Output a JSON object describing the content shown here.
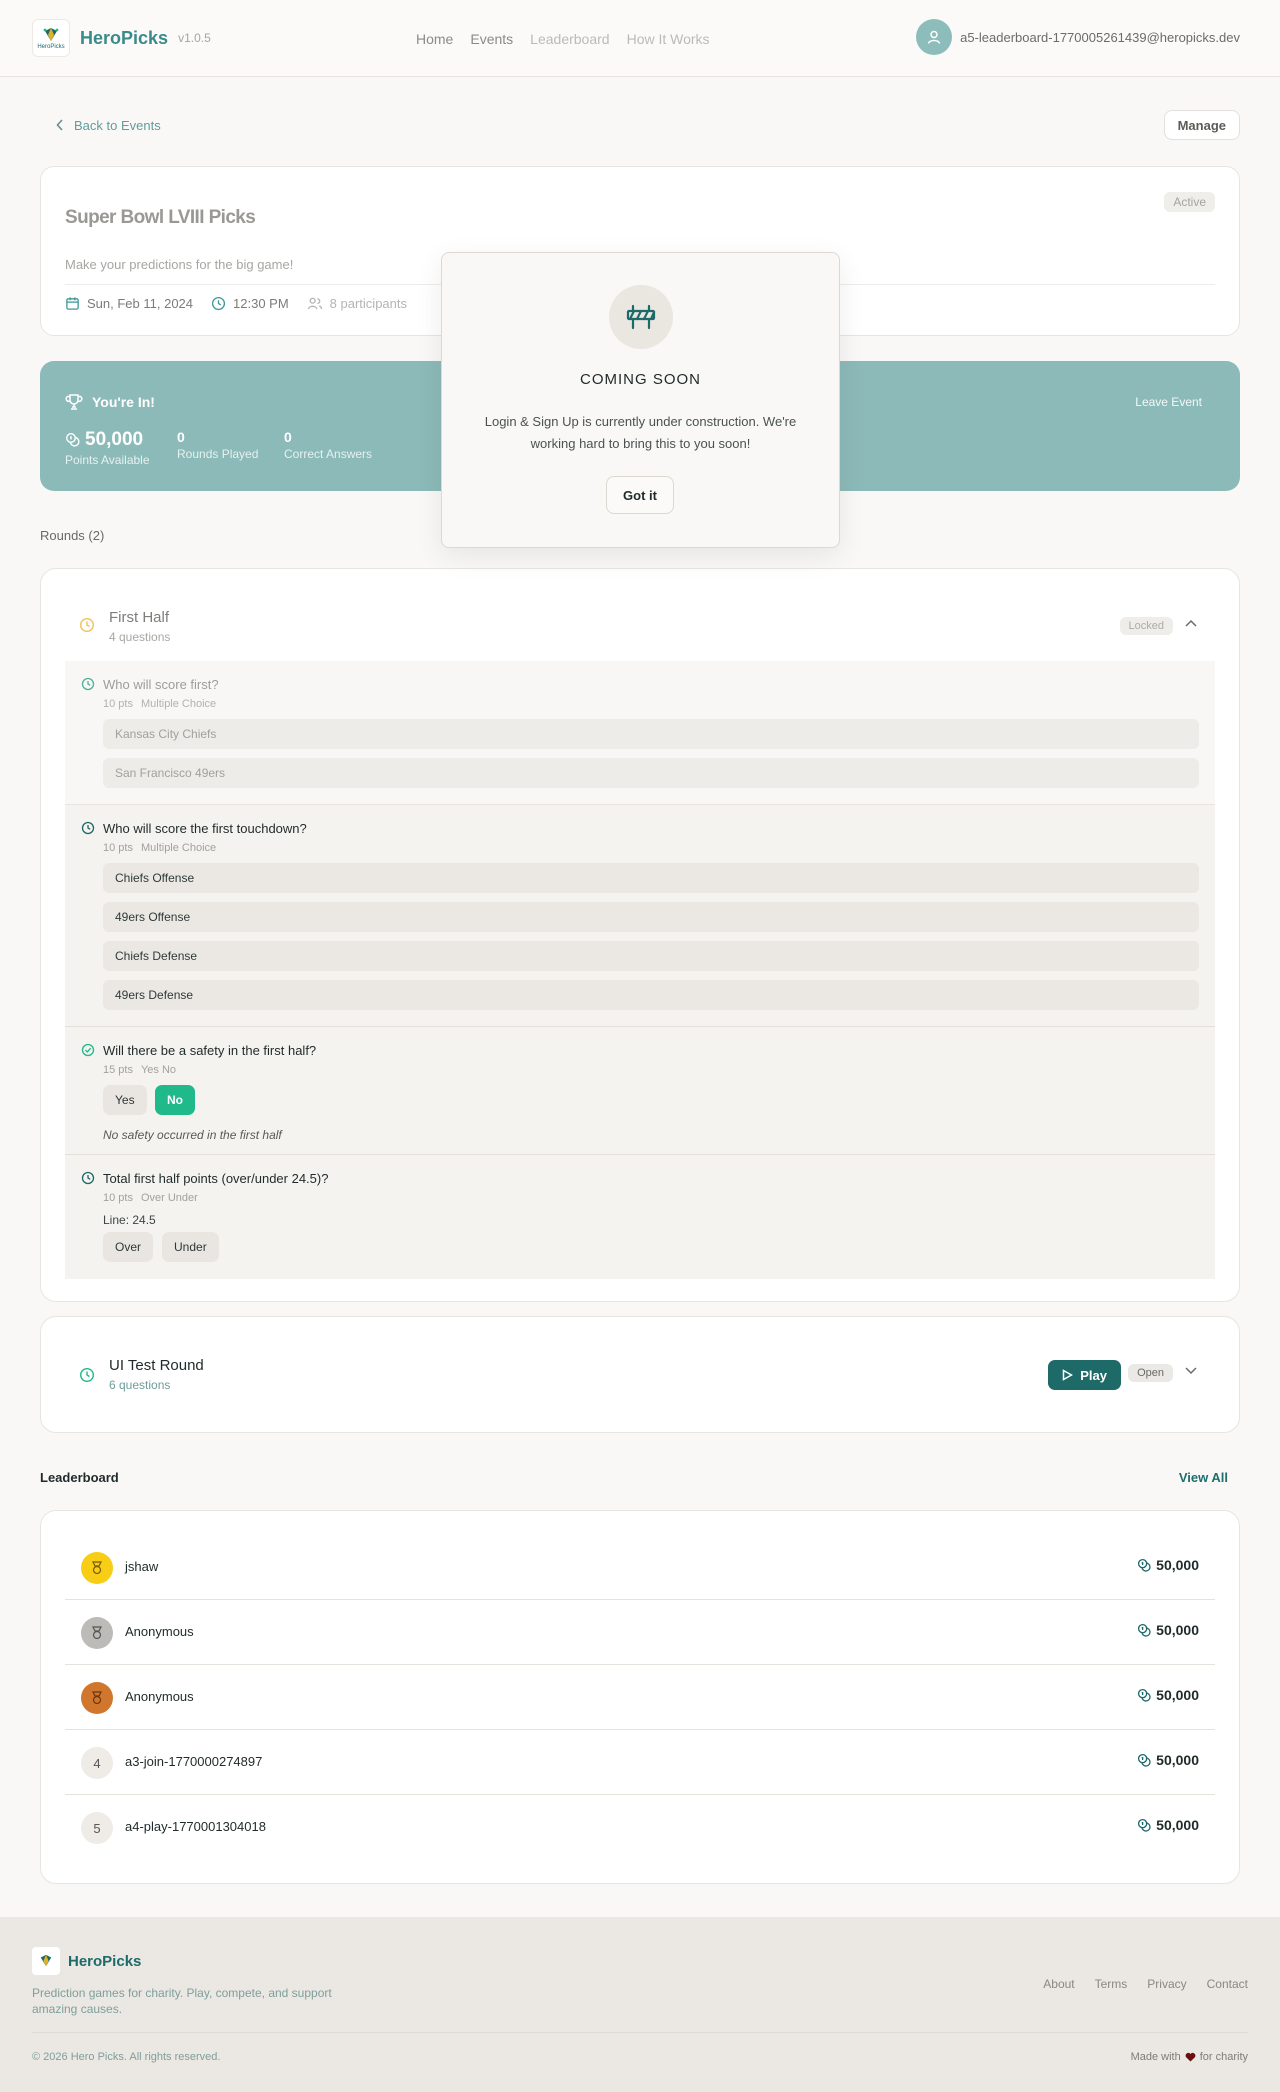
{
  "header": {
    "logo_text": "HeroPicks",
    "brand": "HeroPicks",
    "version": "v1.0.5",
    "nav": [
      "Home",
      "Events",
      "Leaderboard",
      "How It Works"
    ],
    "user_email": "a5-leaderboard-1770005261439@heropicks.dev"
  },
  "back_label": "Back to Events",
  "manage_label": "Manage",
  "event": {
    "title": "Super Bowl LVIII Picks",
    "status": "Active",
    "description": "Make your predictions for the big game!",
    "date": "Sun, Feb 11, 2024",
    "time": "12:30 PM",
    "participants": "8 participants"
  },
  "membership": {
    "title": "You're In!",
    "leave_label": "Leave Event",
    "points_value": "50,000",
    "points_label": "Points Available",
    "rounds_value": "0",
    "rounds_label": "Rounds Played",
    "correct_value": "0",
    "correct_label": "Correct Answers"
  },
  "rounds_title": "Rounds (2)",
  "round1": {
    "title": "First Half",
    "subtitle": "4 questions",
    "status": "Locked",
    "questions": [
      {
        "title": "Who will score first?",
        "points": "10 pts",
        "type": "Multiple Choice",
        "options": [
          "Kansas City Chiefs",
          "San Francisco 49ers"
        ]
      },
      {
        "title": "Who will score the first touchdown?",
        "points": "10 pts",
        "type": "Multiple Choice",
        "options": [
          "Chiefs Offense",
          "49ers Offense",
          "Chiefs Defense",
          "49ers Defense"
        ]
      },
      {
        "title": "Will there be a safety in the first half?",
        "points": "15 pts",
        "type": "Yes No",
        "options": [
          "Yes",
          "No"
        ],
        "selected": "No",
        "note": "No safety occurred in the first half"
      },
      {
        "title": "Total first half points (over/under 24.5)?",
        "points": "10 pts",
        "type": "Over Under",
        "line": "Line: 24.5",
        "options": [
          "Over",
          "Under"
        ]
      }
    ]
  },
  "round2": {
    "title": "UI Test Round",
    "subtitle": "6 questions",
    "play_label": "Play",
    "status": "Open"
  },
  "leaderboard": {
    "title": "Leaderboard",
    "view_all": "View All",
    "rows": [
      {
        "rank": "1",
        "name": "jshaw",
        "points": "50,000"
      },
      {
        "rank": "2",
        "name": "Anonymous",
        "points": "50,000"
      },
      {
        "rank": "3",
        "name": "Anonymous",
        "points": "50,000"
      },
      {
        "rank": "4",
        "name": "a3-join-1770000274897",
        "points": "50,000"
      },
      {
        "rank": "5",
        "name": "a4-play-1770001304018",
        "points": "50,000"
      }
    ]
  },
  "footer": {
    "brand": "HeroPicks",
    "tagline": "Prediction games for charity. Play, compete, and support amazing causes.",
    "links": [
      "About",
      "Terms",
      "Privacy",
      "Contact"
    ],
    "copyright": "© 2026 Hero Picks. All rights reserved.",
    "made_prefix": "Made with",
    "made_suffix": "for charity"
  },
  "modal": {
    "title": "COMING SOON",
    "text": "Login & Sign Up is currently under construction. We're working hard to bring this to you soon!",
    "button": "Got it"
  },
  "colors": {
    "brand_teal": "#1e6a69",
    "success_green": "#1fb98a",
    "banner_teal": "#8cbab8",
    "gold": "#f7cd16",
    "silver": "#bdbbb7",
    "bronze": "#d0772d"
  }
}
